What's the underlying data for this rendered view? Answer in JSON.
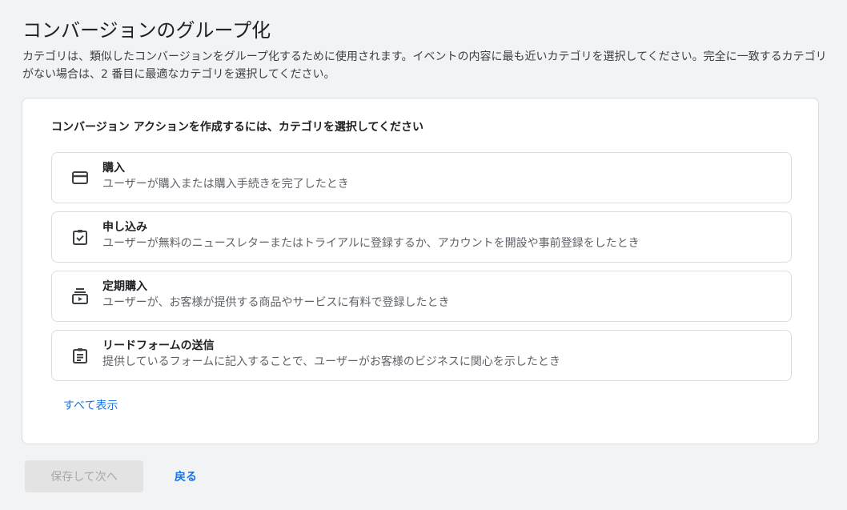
{
  "header": {
    "title": "コンバージョンのグループ化",
    "description": "カテゴリは、類似したコンバージョンをグループ化するために使用されます。イベントの内容に最も近いカテゴリを選択してください。完全に一致するカテゴリがない場合は、2 番目に最適なカテゴリを選択してください。"
  },
  "card": {
    "heading": "コンバージョン アクションを作成するには、カテゴリを選択してください",
    "options": [
      {
        "icon": "credit-card-icon",
        "title": "購入",
        "description": "ユーザーが購入または購入手続きを完了したとき"
      },
      {
        "icon": "clipboard-check-icon",
        "title": "申し込み",
        "description": "ユーザーが無料のニュースレターまたはトライアルに登録するか、アカウントを開設や事前登録をしたとき"
      },
      {
        "icon": "subscriptions-icon",
        "title": "定期購入",
        "description": "ユーザーが、お客様が提供する商品やサービスに有料で登録したとき"
      },
      {
        "icon": "form-clipboard-icon",
        "title": "リードフォームの送信",
        "description": "提供しているフォームに記入することで、ユーザーがお客様のビジネスに関心を示したとき"
      }
    ],
    "show_all_label": "すべて表示"
  },
  "footer": {
    "save_label": "保存して次へ",
    "back_label": "戻る"
  },
  "colors": {
    "accent": "#1a73e8",
    "icon": "#3c4043",
    "border": "#dadce0",
    "background": "#f1f3f4"
  }
}
